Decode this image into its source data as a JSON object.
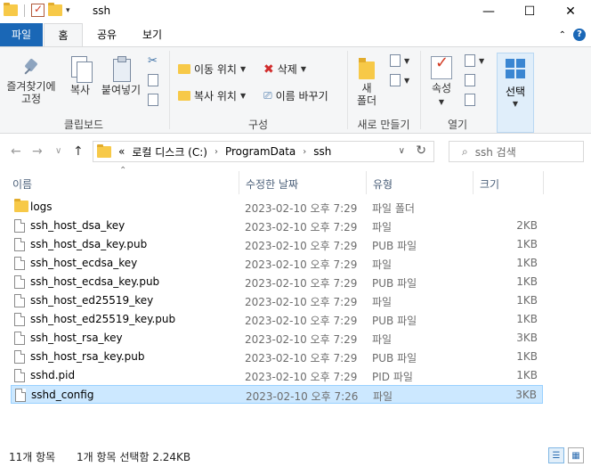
{
  "window": {
    "title": "ssh",
    "minimize": "—",
    "maximize": "☐",
    "close": "✕"
  },
  "tabs": {
    "file": "파일",
    "home": "홈",
    "share": "공유",
    "view": "보기"
  },
  "ribbon": {
    "clipboard": {
      "pin_label": "즐겨찾기에\n고정",
      "copy_label": "복사",
      "paste_label": "붙여넣기",
      "group_label": "클립보드"
    },
    "organize": {
      "move_to": "이동 위치",
      "copy_to": "복사 위치",
      "delete": "삭제",
      "rename": "이름 바꾸기",
      "group_label": "구성"
    },
    "new": {
      "new_folder": "새\n폴더",
      "group_label": "새로 만들기"
    },
    "open": {
      "properties": "속성",
      "group_label": "열기"
    },
    "select": {
      "label": "선택"
    }
  },
  "address": {
    "prefix": "«",
    "crumbs": [
      "로컬 디스크 (C:)",
      "ProgramData",
      "ssh"
    ],
    "search_placeholder": "ssh 검색"
  },
  "columns": {
    "name": "이름",
    "date": "수정한 날짜",
    "type": "유형",
    "size": "크기"
  },
  "files": [
    {
      "name": "logs",
      "date": "2023-02-10 오후 7:29",
      "type": "파일 폴더",
      "size": "",
      "kind": "folder"
    },
    {
      "name": "ssh_host_dsa_key",
      "date": "2023-02-10 오후 7:29",
      "type": "파일",
      "size": "2KB",
      "kind": "file"
    },
    {
      "name": "ssh_host_dsa_key.pub",
      "date": "2023-02-10 오후 7:29",
      "type": "PUB 파일",
      "size": "1KB",
      "kind": "file"
    },
    {
      "name": "ssh_host_ecdsa_key",
      "date": "2023-02-10 오후 7:29",
      "type": "파일",
      "size": "1KB",
      "kind": "file"
    },
    {
      "name": "ssh_host_ecdsa_key.pub",
      "date": "2023-02-10 오후 7:29",
      "type": "PUB 파일",
      "size": "1KB",
      "kind": "file"
    },
    {
      "name": "ssh_host_ed25519_key",
      "date": "2023-02-10 오후 7:29",
      "type": "파일",
      "size": "1KB",
      "kind": "file"
    },
    {
      "name": "ssh_host_ed25519_key.pub",
      "date": "2023-02-10 오후 7:29",
      "type": "PUB 파일",
      "size": "1KB",
      "kind": "file"
    },
    {
      "name": "ssh_host_rsa_key",
      "date": "2023-02-10 오후 7:29",
      "type": "파일",
      "size": "3KB",
      "kind": "file"
    },
    {
      "name": "ssh_host_rsa_key.pub",
      "date": "2023-02-10 오후 7:29",
      "type": "PUB 파일",
      "size": "1KB",
      "kind": "file"
    },
    {
      "name": "sshd.pid",
      "date": "2023-02-10 오후 7:29",
      "type": "PID 파일",
      "size": "1KB",
      "kind": "file"
    },
    {
      "name": "sshd_config",
      "date": "2023-02-10 오후 7:26",
      "type": "파일",
      "size": "3KB",
      "kind": "file",
      "selected": true
    }
  ],
  "status": {
    "count": "11개 항목",
    "selection": "1개 항목 선택함 2.24KB"
  },
  "colors": {
    "file_tab": "#1a67b6",
    "selection": "#cce8ff",
    "folder": "#f7c948"
  }
}
